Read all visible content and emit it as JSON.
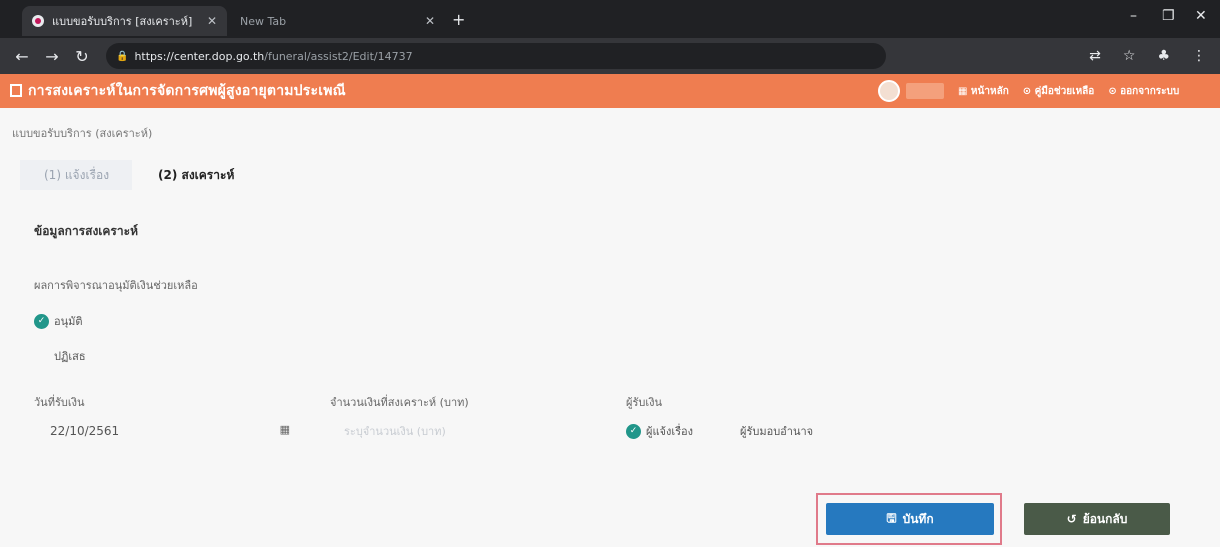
{
  "browser": {
    "active_tab_title": "แบบขอรับบริการ [สงเคราะห์]",
    "inactive_tab_title": "New Tab",
    "tab_close": "✕",
    "new_tab": "+",
    "url_host": "https://center.dop.go.th",
    "url_path": "/funeral/assist2/Edit/14737",
    "window_controls": [
      "–",
      "❐",
      "✕"
    ],
    "toolbar_icons": [
      "translate-icon",
      "star-icon",
      "extension-icon",
      "menu-icon"
    ]
  },
  "header": {
    "title": "การสงเคราะห์ในการจัดการศพผู้สูงอายุตามประเพณี",
    "menu": [
      "▦ หน้าหลัก",
      "⊙ คู่มือช่วยเหลือ",
      "⊙ ออกจากระบบ"
    ],
    "accent_color": "#ef7d50"
  },
  "breadcrumb": "แบบขอรับบริการ (สงเคราะห์)",
  "steps": [
    {
      "label": "(1) แจ้งเรื่อง"
    },
    {
      "label": "(2) สงเคราะห์"
    }
  ],
  "section_title": "ข้อมูลการสงเคราะห์",
  "consideration": {
    "label": "ผลการพิจารณาอนุมัติเงินช่วยเหลือ",
    "approve": "อนุมัติ",
    "reject": "ปฏิเสธ",
    "selected": "อนุมัติ"
  },
  "date_field": {
    "label": "วันที่รับเงิน",
    "value": "22/10/2561"
  },
  "amount_field": {
    "label": "จำนวนเงินที่สงเคราะห์ (บาท)",
    "placeholder": "ระบุจำนวนเงิน (บาท)"
  },
  "recipient": {
    "label": "ผู้รับเงิน",
    "option_requester": "ผู้แจ้งเรื่อง",
    "option_other": "ผู้รับมอบอำนาจ",
    "selected": "ผู้แจ้งเรื่อง"
  },
  "buttons": {
    "save": "บันทึก",
    "back": "ย้อนกลับ"
  },
  "colors": {
    "radio_selected": "#21968a",
    "save_button": "#2679bf",
    "back_button": "#4a5a48",
    "highlight": "#e07a8a"
  }
}
